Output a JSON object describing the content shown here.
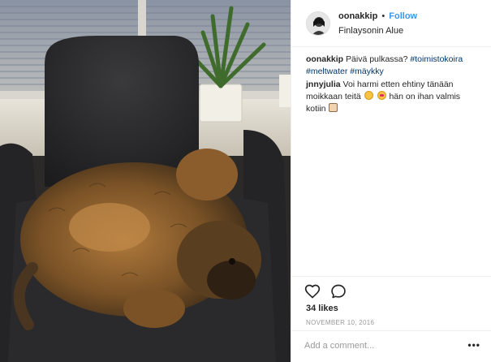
{
  "post": {
    "username": "oonakkip",
    "separator": "•",
    "follow_label": "Follow",
    "location": "Finlaysonin Alue"
  },
  "caption": {
    "user": "oonakkip",
    "text": "Päivä pulkassa?",
    "tags": [
      "#toimistokoira",
      "#meltwater",
      "#mäykky"
    ]
  },
  "comment": {
    "user": "jnnyjulia",
    "text_part1": "Voi harmi etten ehtiny tänään moikkaan teitä",
    "text_part2": "hän on ihan valmis kotiin"
  },
  "likes_text": "34 likes",
  "date_text": "NOVEMBER 10, 2016",
  "add_comment_placeholder": "Add a comment...",
  "more_label": "•••",
  "icons": {
    "like": "heart-outline-icon",
    "comment": "speech-bubble-icon",
    "emoji1": "slightly-smiling-face-icon",
    "emoji2": "heart-eyes-face-icon",
    "emoji3": "person-icon"
  },
  "colors": {
    "accent": "#3897f0",
    "hashtag": "#003569",
    "muted": "#999999",
    "text": "#262626",
    "divider": "#efefef"
  }
}
